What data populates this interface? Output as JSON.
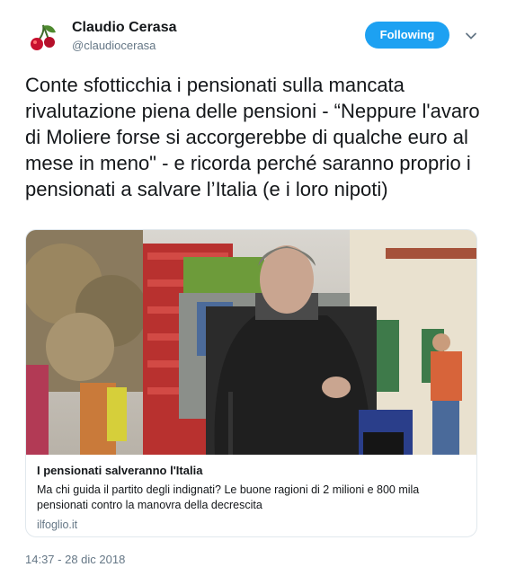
{
  "author": {
    "display_name": "Claudio Cerasa",
    "handle": "@claudiocerasa"
  },
  "follow_button": {
    "label": "Following"
  },
  "tweet": {
    "text": "Conte sfotticchia i pensionati sulla mancata rivalutazione piena delle pensioni  - “Neppure l'avaro di Moliere forse si accorgerebbe di qualche euro al mese in meno\" - e ricorda perché saranno proprio i pensionati a salvare l’Italia (e i loro nipoti)",
    "timestamp": "14:37 - 28 dic 2018"
  },
  "link_card": {
    "title": "I pensionati salveranno l'Italia",
    "description": "Ma chi guida il partito degli indignati? Le buone ragioni di 2 milioni e 800 mila pensionati contro la manovra della decrescita",
    "domain": "ilfoglio.it"
  },
  "colors": {
    "accent": "#1da1f2",
    "text": "#14171a",
    "secondary_text": "#657786",
    "border": "#e1e8ed"
  },
  "icons": {
    "avatar": "cherry-avatar",
    "chevron": "chevron-down-icon"
  }
}
